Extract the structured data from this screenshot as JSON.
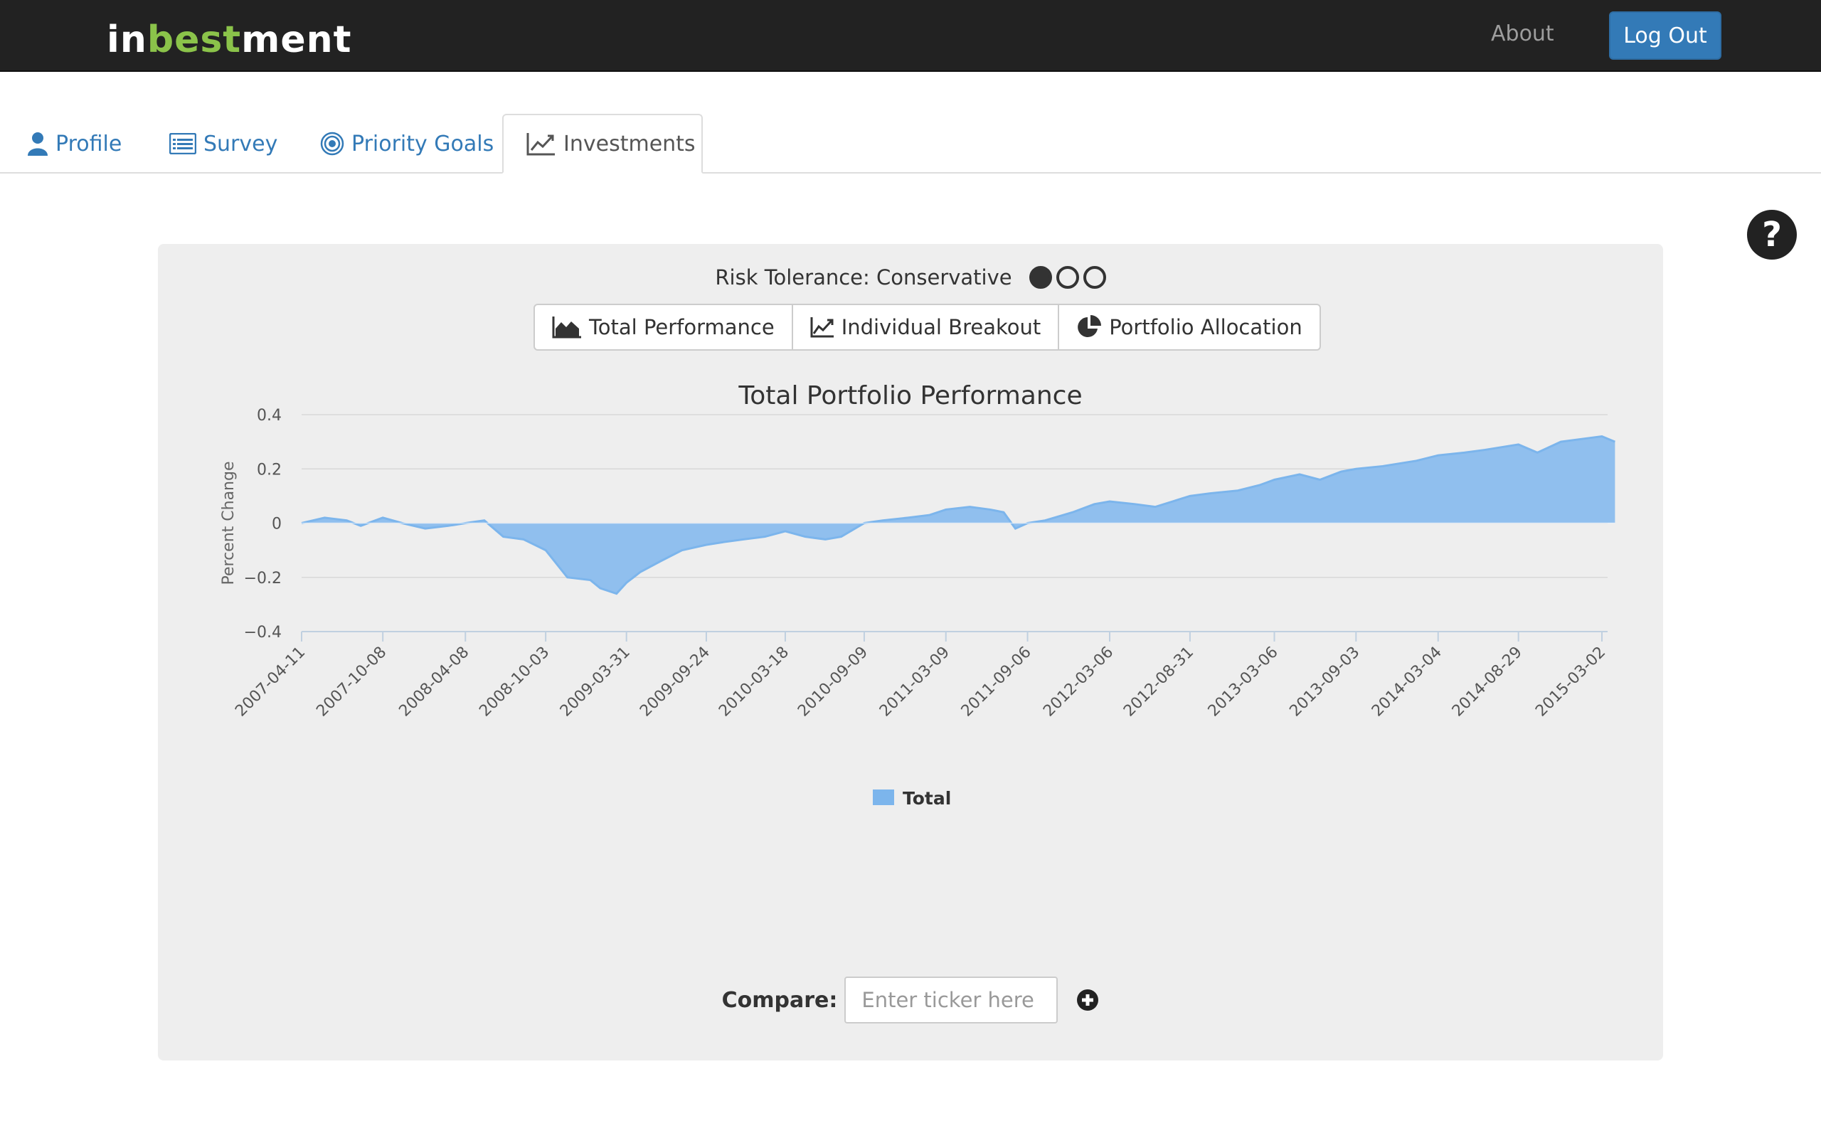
{
  "navbar": {
    "brand_pre": "in",
    "brand_hl": "best",
    "brand_post": "ment",
    "about": "About",
    "logout": "Log Out"
  },
  "tabs": [
    {
      "label": "Profile",
      "icon": "user-icon"
    },
    {
      "label": "Survey",
      "icon": "list-icon"
    },
    {
      "label": "Priority Goals",
      "icon": "target-icon"
    },
    {
      "label": "Investments",
      "icon": "line-chart-icon",
      "active": true
    }
  ],
  "risk": {
    "label": "Risk Tolerance: Conservative",
    "level": 1,
    "max": 3
  },
  "views": [
    {
      "label": "Total Performance",
      "icon": "area-chart-icon"
    },
    {
      "label": "Individual Breakout",
      "icon": "line-chart-icon"
    },
    {
      "label": "Portfolio Allocation",
      "icon": "pie-chart-icon"
    }
  ],
  "compare": {
    "label": "Compare:",
    "placeholder": "Enter ticker here"
  },
  "colors": {
    "accent": "#337ab7",
    "area_fill": "#90bfee",
    "area_line": "#7cb5ec",
    "navbar": "#222222"
  },
  "chart_data": {
    "type": "area",
    "title": "Total Portfolio Performance",
    "ylabel": "Percent Change",
    "xlabel": "",
    "ylim": [
      -0.4,
      0.4
    ],
    "yticks": [
      "0.4",
      "0.2",
      "0",
      "−0.2",
      "−0.4"
    ],
    "xticks": [
      "2007-04-11",
      "2007-10-08",
      "2008-04-08",
      "2008-10-03",
      "2009-03-31",
      "2009-09-24",
      "2010-03-18",
      "2010-09-09",
      "2011-03-09",
      "2011-09-06",
      "2012-03-06",
      "2012-08-31",
      "2013-03-06",
      "2013-09-03",
      "2014-03-04",
      "2014-08-29",
      "2015-03-02"
    ],
    "grid": true,
    "legend": "bottom-center",
    "series": [
      {
        "name": "Total",
        "x": [
          "2007-04-11",
          "2007-06-01",
          "2007-07-20",
          "2007-08-20",
          "2007-10-08",
          "2007-11-20",
          "2008-01-10",
          "2008-03-01",
          "2008-04-08",
          "2008-05-20",
          "2008-07-01",
          "2008-08-15",
          "2008-10-03",
          "2008-11-20",
          "2009-01-10",
          "2009-02-01",
          "2009-03-09",
          "2009-03-31",
          "2009-05-01",
          "2009-06-15",
          "2009-08-01",
          "2009-09-24",
          "2009-11-01",
          "2009-12-15",
          "2010-02-01",
          "2010-03-18",
          "2010-05-01",
          "2010-06-15",
          "2010-07-20",
          "2010-09-09",
          "2010-10-20",
          "2010-12-15",
          "2011-02-01",
          "2011-03-09",
          "2011-05-01",
          "2011-06-15",
          "2011-07-15",
          "2011-08-10",
          "2011-09-06",
          "2011-10-15",
          "2011-12-15",
          "2012-02-01",
          "2012-03-06",
          "2012-05-01",
          "2012-06-15",
          "2012-08-31",
          "2012-10-15",
          "2012-12-15",
          "2013-02-01",
          "2013-03-06",
          "2013-05-01",
          "2013-06-15",
          "2013-08-01",
          "2013-09-03",
          "2013-11-01",
          "2014-01-15",
          "2014-03-04",
          "2014-05-01",
          "2014-06-15",
          "2014-08-29",
          "2014-10-10",
          "2014-12-01",
          "2015-01-15",
          "2015-03-02",
          "2015-03-31"
        ],
        "values": [
          0.0,
          0.02,
          0.01,
          -0.01,
          0.02,
          0.0,
          -0.02,
          -0.01,
          0.0,
          0.01,
          -0.05,
          -0.06,
          -0.1,
          -0.2,
          -0.21,
          -0.24,
          -0.26,
          -0.22,
          -0.18,
          -0.14,
          -0.1,
          -0.08,
          -0.07,
          -0.06,
          -0.05,
          -0.03,
          -0.05,
          -0.06,
          -0.05,
          0.0,
          0.01,
          0.02,
          0.03,
          0.05,
          0.06,
          0.05,
          0.04,
          -0.02,
          0.0,
          0.01,
          0.04,
          0.07,
          0.08,
          0.07,
          0.06,
          0.1,
          0.11,
          0.12,
          0.14,
          0.16,
          0.18,
          0.16,
          0.19,
          0.2,
          0.21,
          0.23,
          0.25,
          0.26,
          0.27,
          0.29,
          0.26,
          0.3,
          0.31,
          0.32,
          0.3
        ]
      }
    ]
  }
}
